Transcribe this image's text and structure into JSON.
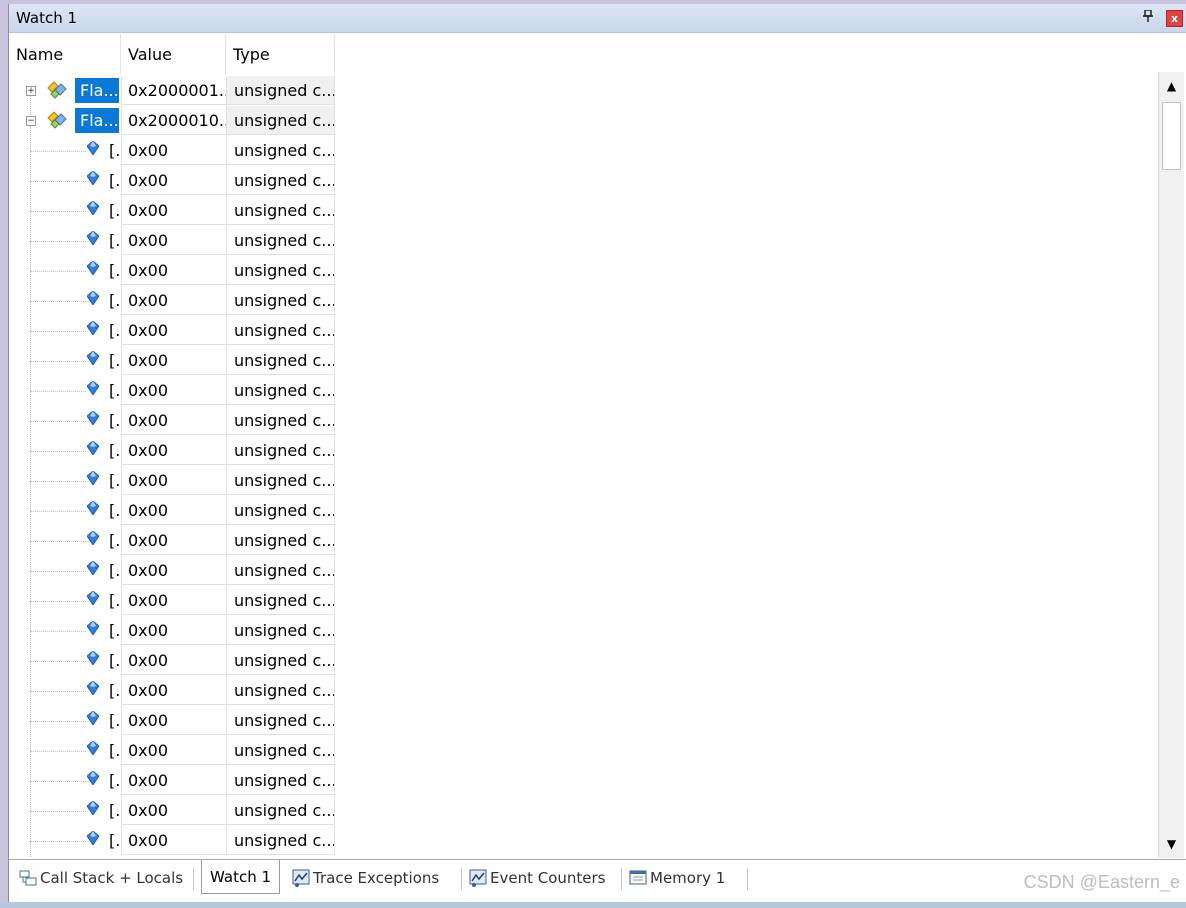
{
  "window": {
    "title": "Watch 1",
    "pin_glyph": "ᵖ",
    "close_glyph": "x"
  },
  "columns": {
    "name": "Name",
    "value": "Value",
    "type": "Type"
  },
  "parents": [
    {
      "name": "Fla...",
      "value": "0x2000001...",
      "type": "unsigned c...",
      "expanded": false
    },
    {
      "name": "Fla...",
      "value": "0x2000010...",
      "type": "unsigned c...",
      "expanded": true
    }
  ],
  "children": [
    {
      "name": "[...",
      "value": "0x00",
      "type": "unsigned c..."
    },
    {
      "name": "[...",
      "value": "0x00",
      "type": "unsigned c..."
    },
    {
      "name": "[...",
      "value": "0x00",
      "type": "unsigned c..."
    },
    {
      "name": "[...",
      "value": "0x00",
      "type": "unsigned c..."
    },
    {
      "name": "[...",
      "value": "0x00",
      "type": "unsigned c..."
    },
    {
      "name": "[...",
      "value": "0x00",
      "type": "unsigned c..."
    },
    {
      "name": "[...",
      "value": "0x00",
      "type": "unsigned c..."
    },
    {
      "name": "[...",
      "value": "0x00",
      "type": "unsigned c..."
    },
    {
      "name": "[...",
      "value": "0x00",
      "type": "unsigned c..."
    },
    {
      "name": "[...",
      "value": "0x00",
      "type": "unsigned c..."
    },
    {
      "name": "[...",
      "value": "0x00",
      "type": "unsigned c..."
    },
    {
      "name": "[...",
      "value": "0x00",
      "type": "unsigned c..."
    },
    {
      "name": "[...",
      "value": "0x00",
      "type": "unsigned c..."
    },
    {
      "name": "[...",
      "value": "0x00",
      "type": "unsigned c..."
    },
    {
      "name": "[...",
      "value": "0x00",
      "type": "unsigned c..."
    },
    {
      "name": "[...",
      "value": "0x00",
      "type": "unsigned c..."
    },
    {
      "name": "[...",
      "value": "0x00",
      "type": "unsigned c..."
    },
    {
      "name": "[...",
      "value": "0x00",
      "type": "unsigned c..."
    },
    {
      "name": "[...",
      "value": "0x00",
      "type": "unsigned c..."
    },
    {
      "name": "[...",
      "value": "0x00",
      "type": "unsigned c..."
    },
    {
      "name": "[...",
      "value": "0x00",
      "type": "unsigned c..."
    },
    {
      "name": "[...",
      "value": "0x00",
      "type": "unsigned c..."
    },
    {
      "name": "[...",
      "value": "0x00",
      "type": "unsigned c..."
    },
    {
      "name": "[...",
      "value": "0x00",
      "type": "unsigned c..."
    }
  ],
  "scrollbar": {
    "up_glyph": "▲",
    "down_glyph": "▼"
  },
  "tabs": [
    {
      "label": "Call Stack + Locals",
      "icon": "call-stack-icon",
      "active": false
    },
    {
      "label": "Watch 1",
      "icon": "",
      "active": true
    },
    {
      "label": "Trace Exceptions",
      "icon": "trace-exceptions-icon",
      "active": false
    },
    {
      "label": "Event Counters",
      "icon": "event-counters-icon",
      "active": false
    },
    {
      "label": "Memory 1",
      "icon": "memory-icon",
      "active": false
    }
  ],
  "watermark": "CSDN @Eastern_e",
  "colors": {
    "selection": "#0a78d7",
    "title_bg": "#dce6f4",
    "close": "#e04343"
  }
}
